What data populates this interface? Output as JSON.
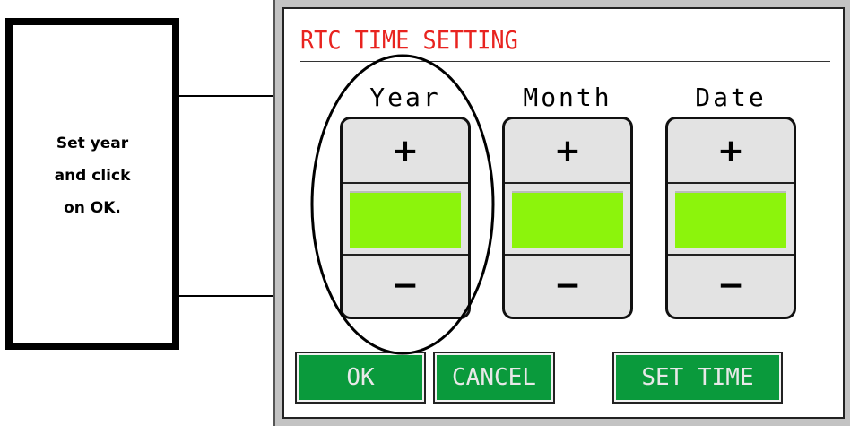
{
  "callout": {
    "text": "Set year\nand click\non OK."
  },
  "screen": {
    "title": "RTC TIME SETTING",
    "columns": [
      {
        "label": "Year",
        "plus": "+",
        "minus": "−"
      },
      {
        "label": "Month",
        "plus": "+",
        "minus": "−"
      },
      {
        "label": "Date",
        "plus": "+",
        "minus": "−"
      }
    ],
    "buttons": {
      "ok": "OK",
      "cancel": "CANCEL",
      "set_time": "SET TIME"
    }
  },
  "colors": {
    "title": "#e8231f",
    "value_field": "#8cf40c",
    "button_bg": "#0a9a3c"
  }
}
